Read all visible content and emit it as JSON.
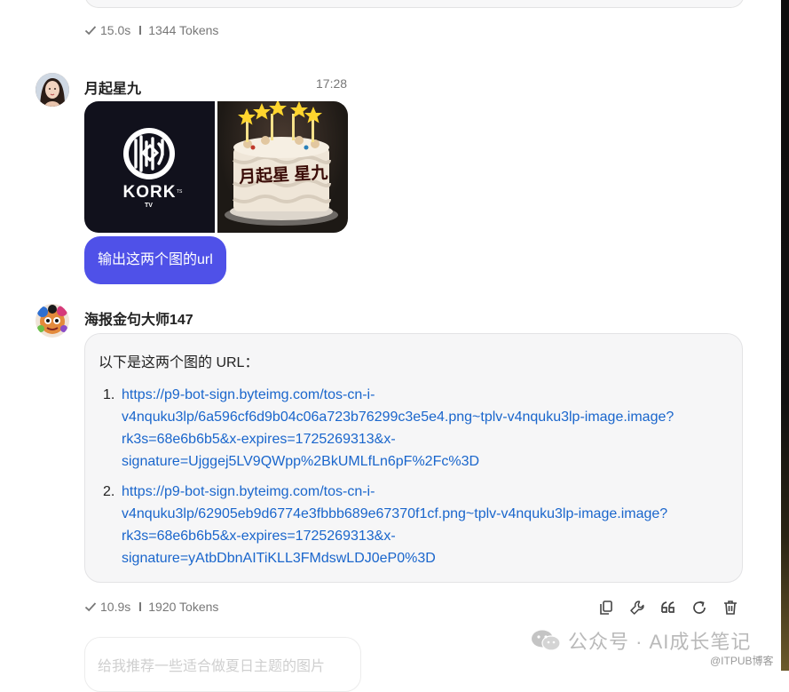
{
  "prev_meta": {
    "duration": "15.0s",
    "tokens": "1344 Tokens"
  },
  "user_message": {
    "name": "月起星九",
    "time": "17:28",
    "images": [
      {
        "logo_text": "KORK",
        "sub": "TV",
        "mark": "TS"
      },
      {
        "cake_text": "月起星 星九"
      }
    ],
    "text": "输出这两个图的url"
  },
  "bot_message": {
    "name": "海报金句大师147",
    "intro": "以下是这两个图的 URL：",
    "urls": [
      {
        "num": "1.",
        "lines": [
          "https://p9-bot-sign.byteimg.com/tos-cn-i-",
          "v4nquku3lp/6a596cf6d9b04c06a723b76299c3e5e4.png~tplv-v4nquku3lp-image.image?",
          "rk3s=68e6b6b5&x-expires=1725269313&x-",
          "signature=Ujggej5LV9QWpp%2BkUMLfLn6pF%2Fc%3D"
        ]
      },
      {
        "num": "2.",
        "lines": [
          "https://p9-bot-sign.byteimg.com/tos-cn-i-",
          "v4nquku3lp/62905eb9d6774e3fbbb689e67370f1cf.png~tplv-v4nquku3lp-image.image?",
          "rk3s=68e6b6b5&x-expires=1725269313&x-",
          "signature=yAtbDbnAITiKLL3FMdswLDJ0eP0%3D"
        ]
      }
    ]
  },
  "bot_meta": {
    "duration": "10.9s",
    "tokens": "1920 Tokens"
  },
  "actions": [
    "copy-icon",
    "wrench-icon",
    "quote-icon",
    "refresh-icon",
    "trash-icon"
  ],
  "next_input_text": "给我推荐一些适合做夏日主题的图片",
  "watermark": {
    "main": "公众号 · AI成长笔记",
    "sub": "@ITPUB博客"
  },
  "colors": {
    "user_bubble": "#4f51e8",
    "link": "#1a66cc",
    "bot_bubble": "#f6f6f7"
  }
}
